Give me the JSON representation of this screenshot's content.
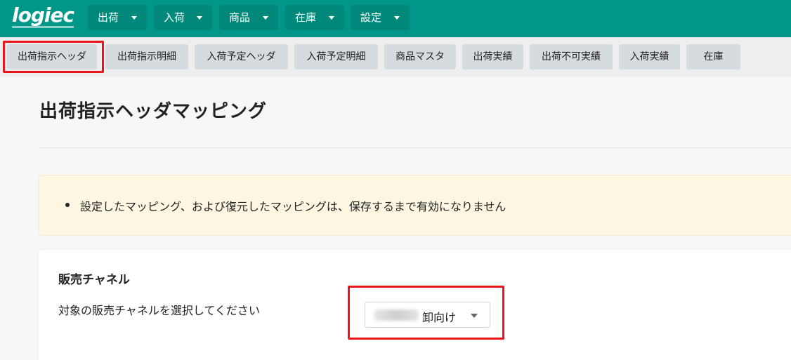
{
  "brand": {
    "logo_text": "logiec",
    "primary_color": "#009688",
    "highlight_color": "#e8161b"
  },
  "topnav": {
    "items": [
      {
        "label": "出荷",
        "icon": "chevron-down-icon"
      },
      {
        "label": "入荷",
        "icon": "chevron-down-icon"
      },
      {
        "label": "商品",
        "icon": "chevron-down-icon"
      },
      {
        "label": "在庫",
        "icon": "chevron-down-icon"
      },
      {
        "label": "設定",
        "icon": "chevron-down-icon"
      }
    ]
  },
  "subtabs": {
    "items": [
      {
        "label": "出荷指示ヘッダ",
        "active": true
      },
      {
        "label": "出荷指示明細"
      },
      {
        "label": "入荷予定ヘッダ"
      },
      {
        "label": "入荷予定明細"
      },
      {
        "label": "商品マスタ"
      },
      {
        "label": "出荷実績"
      },
      {
        "label": "出荷不可実績"
      },
      {
        "label": "入荷実績"
      },
      {
        "label": "在庫"
      }
    ]
  },
  "main": {
    "title": "出荷指示ヘッダマッピング",
    "notice": "設定したマッピング、および復元したマッピングは、保存するまで有効になりません",
    "channel_card": {
      "title": "販売チャネル",
      "label": "対象の販売チャネルを選択してください",
      "select_value": "卸向け"
    }
  }
}
